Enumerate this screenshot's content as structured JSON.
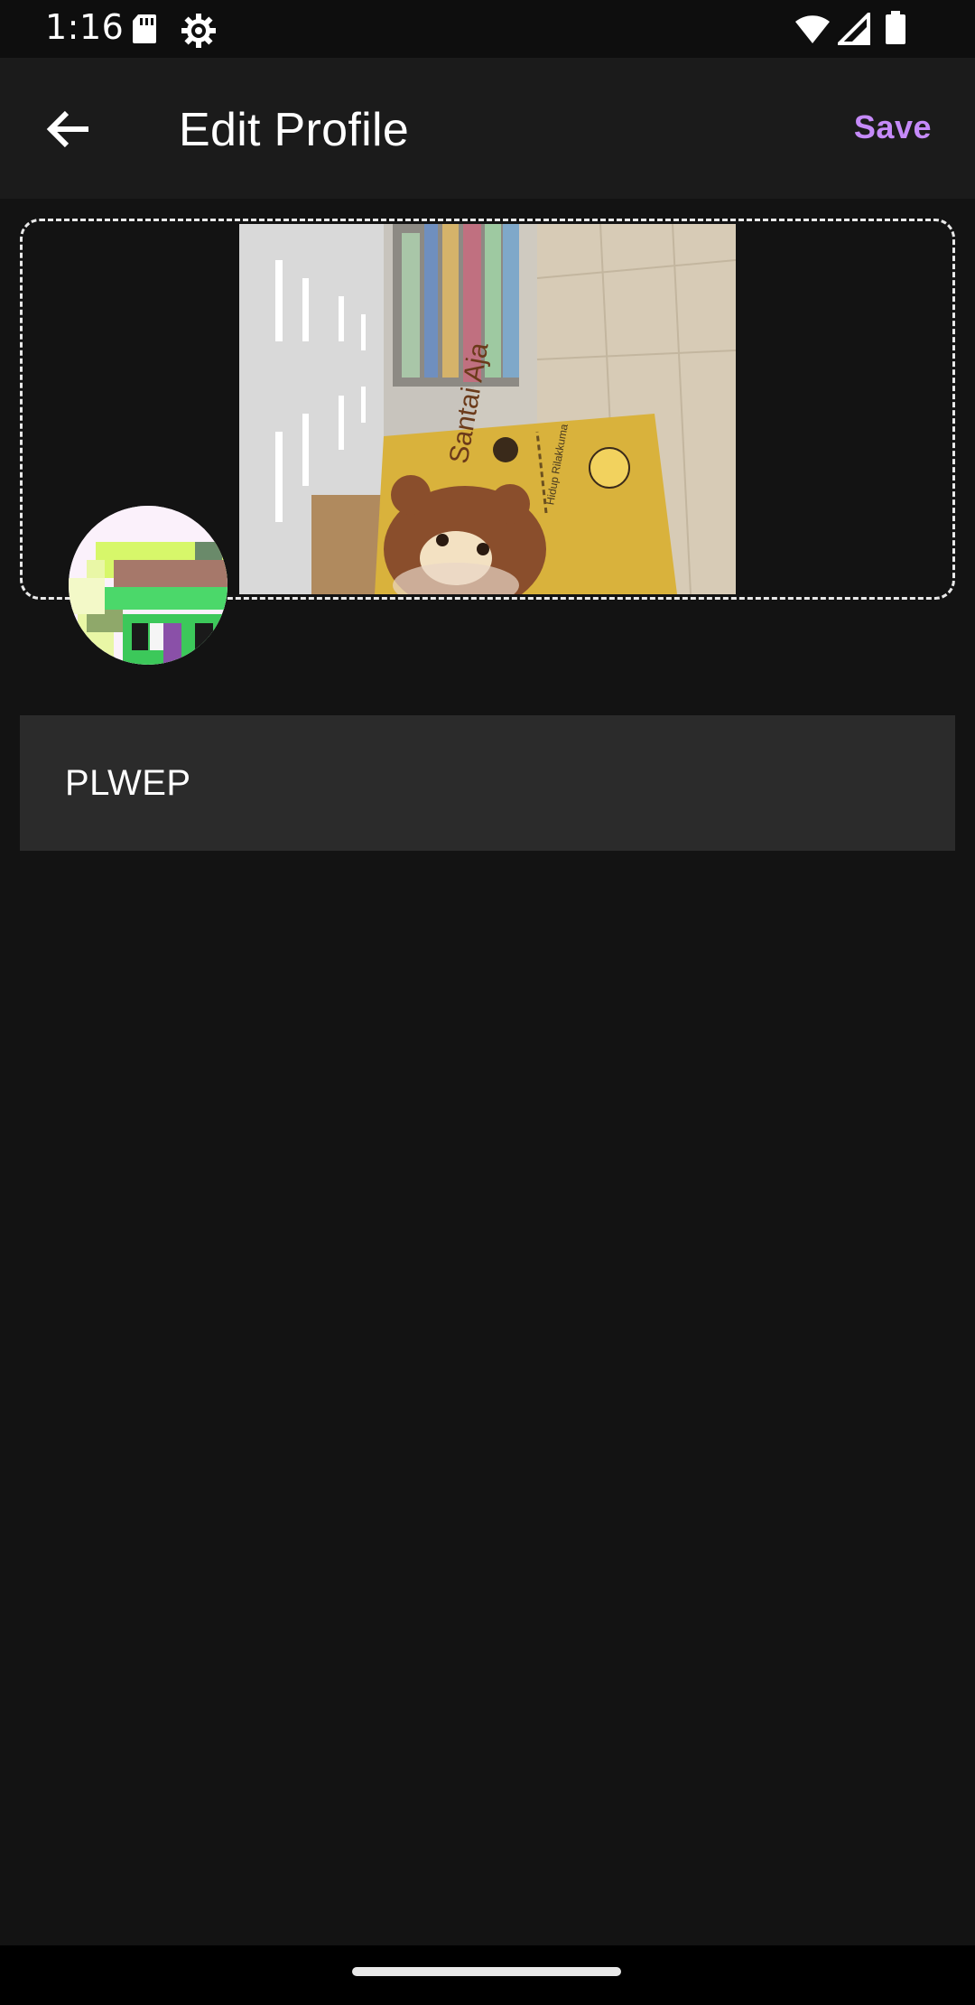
{
  "status_bar": {
    "time": "1:16",
    "icons": [
      "sd-card-icon",
      "settings-icon",
      "wifi-icon",
      "signal-icon",
      "battery-icon"
    ]
  },
  "app_bar": {
    "back_icon": "arrow-left-icon",
    "title": "Edit Profile",
    "save_label": "Save"
  },
  "cover": {
    "image": "cover-photo",
    "book_title_text": "Santai Aja",
    "book_subtitle_text": "Hidup Rilakkuma"
  },
  "avatar": {
    "image": "pixel-avatar"
  },
  "profile": {
    "name_value": "PLWEP"
  },
  "colors": {
    "background": "#131313",
    "app_bar": "#1b1b1b",
    "accent": "#c58af9",
    "field": "#2b2b2b"
  }
}
